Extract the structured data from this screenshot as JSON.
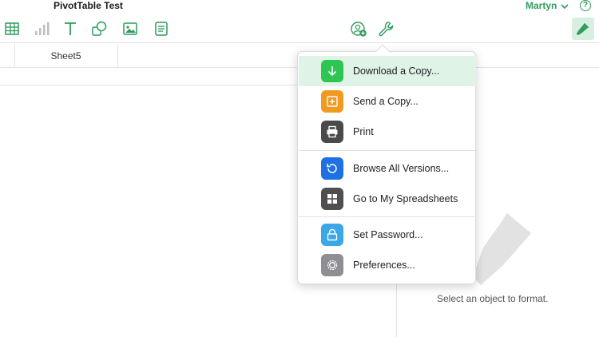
{
  "header": {
    "doc_title": "PivotTable Test",
    "user_name": "Martyn",
    "help_glyph": "?",
    "accent_color": "#2e9c5a"
  },
  "toolbar": {
    "icons": [
      "table-icon",
      "chart-icon",
      "text-icon",
      "shape-icon",
      "media-icon",
      "comment-icon",
      "collaborate-icon",
      "tools-wrench-icon",
      "format-brush-icon"
    ]
  },
  "tabs": {
    "sheet_name": "Sheet5"
  },
  "menu": {
    "items": [
      {
        "label": "Download a Copy...",
        "icon": "download-icon",
        "color": "#2dc653"
      },
      {
        "label": "Send a Copy...",
        "icon": "send-copy-icon",
        "color": "#f19a22"
      },
      {
        "label": "Print",
        "icon": "printer-icon",
        "color": "#4a4a4a"
      },
      {
        "label": "Browse All Versions...",
        "icon": "versions-icon",
        "color": "#1f6fe5"
      },
      {
        "label": "Go to My Spreadsheets",
        "icon": "spreadsheets-grid-icon",
        "color": "#4f4f4f"
      },
      {
        "label": "Set Password...",
        "icon": "lock-icon",
        "color": "#3aa7e6"
      },
      {
        "label": "Preferences...",
        "icon": "gear-icon",
        "color": "#8e8e93"
      }
    ]
  },
  "inspector": {
    "message": "Select an object to format."
  }
}
